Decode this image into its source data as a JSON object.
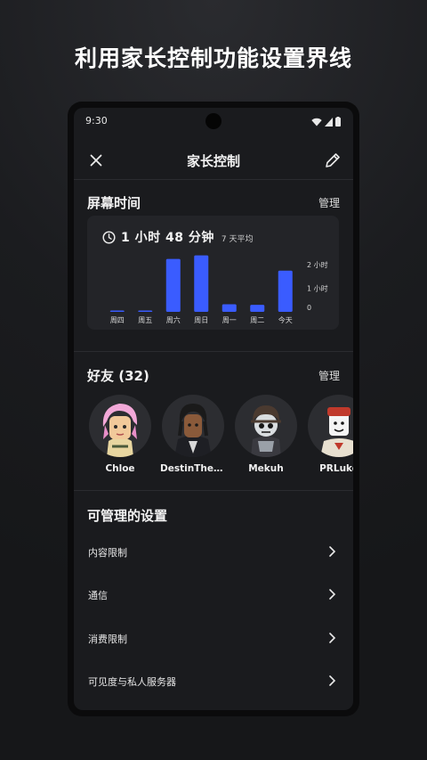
{
  "headline": "利用家长控制功能设置界线",
  "status_bar": {
    "time": "9:30"
  },
  "app_bar": {
    "title": "家长控制",
    "close_icon": "close-icon",
    "edit_icon": "pencil-icon"
  },
  "screen_time": {
    "title": "屏幕时间",
    "manage_label": "管理",
    "average_value": "1 小时 48 分钟",
    "average_caption": "7 天平均",
    "clock_icon": "clock-icon"
  },
  "chart_data": {
    "type": "bar",
    "categories": [
      "周四",
      "周五",
      "周六",
      "周日",
      "周一",
      "周二",
      "今天"
    ],
    "values": [
      0.03,
      0.03,
      2.25,
      2.4,
      0.32,
      0.3,
      1.75
    ],
    "y_ticks": [
      {
        "value": 2,
        "label": "2 小时"
      },
      {
        "value": 1,
        "label": "1 小时"
      },
      {
        "value": 0,
        "label": "0"
      }
    ],
    "ylim": [
      0,
      2.5
    ],
    "bar_color": "#3a5cff"
  },
  "friends": {
    "title": "好友 (32)",
    "manage_label": "管理",
    "items": [
      {
        "name": "Chloe",
        "avatar": "avatar-chloe"
      },
      {
        "name": "DestinTheL...",
        "avatar": "avatar-destin"
      },
      {
        "name": "Mekuh",
        "avatar": "avatar-mekuh"
      },
      {
        "name": "PRLuke",
        "avatar": "avatar-prluke"
      }
    ]
  },
  "settings": {
    "title": "可管理的设置",
    "items": [
      {
        "label": "内容限制"
      },
      {
        "label": "通信"
      },
      {
        "label": "消费限制"
      },
      {
        "label": "可见度与私人服务器"
      }
    ]
  },
  "colors": {
    "accent": "#3a5cff",
    "background": "#1a1b1e",
    "card": "#232428"
  }
}
